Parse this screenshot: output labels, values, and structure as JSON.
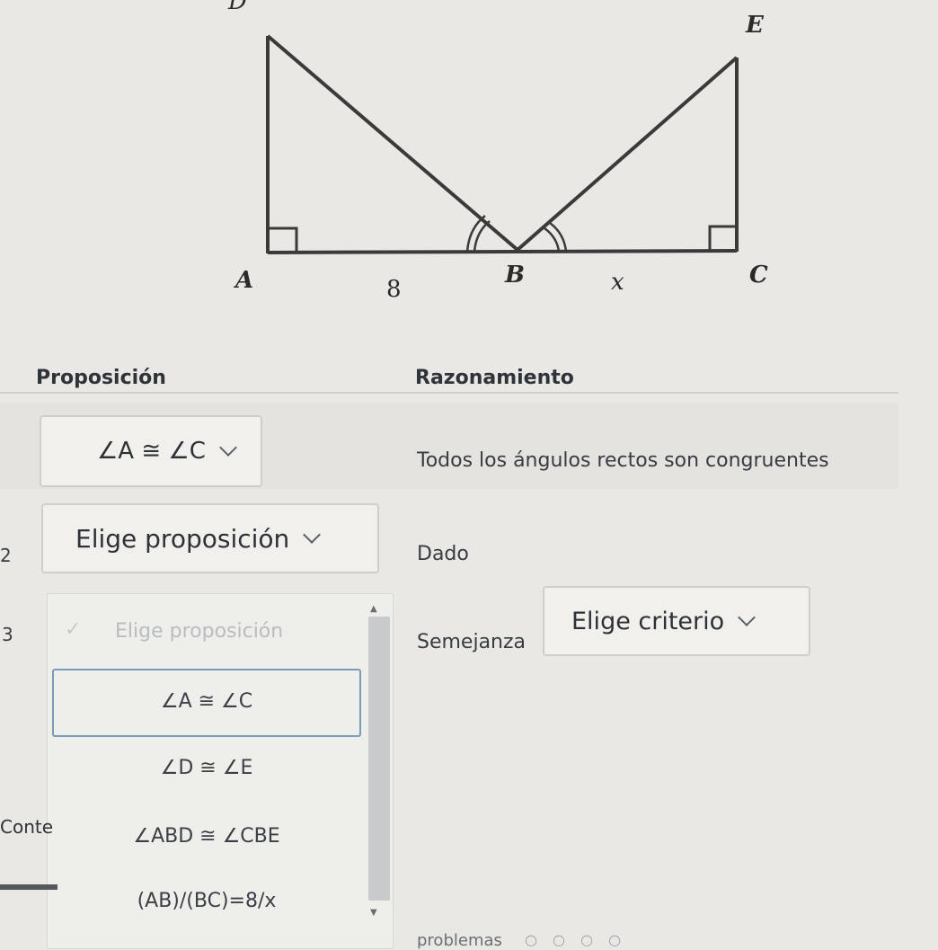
{
  "figure": {
    "labels": {
      "A": "A",
      "B": "B",
      "C": "C",
      "D": "D",
      "E": "E"
    },
    "segment_AB": "8",
    "segment_BC": "x"
  },
  "table": {
    "header_proposition": "Proposición",
    "header_reasoning": "Razonamiento",
    "rows": [
      {
        "number": "",
        "proposition": "∠A ≅ ∠C",
        "reasoning": "Todos los ángulos rectos son congruentes"
      },
      {
        "number": "2",
        "proposition": "Elige proposición",
        "reasoning": "Dado"
      },
      {
        "number": "3",
        "proposition": "Elige proposición",
        "reasoning": "Semejanza",
        "criterion": "Elige criterio"
      }
    ]
  },
  "dropdown": {
    "placeholder": "Elige proposición",
    "check_glyph": "✓",
    "options": [
      "∠A ≅ ∠C",
      "∠D ≅ ∠E",
      "∠ABD ≅ ∠CBE",
      "(AB)/(BC)=8/x"
    ],
    "selected_index": 0
  },
  "side": {
    "label": "Conte"
  },
  "footer": {
    "label": "problemas",
    "dots": "○ ○ ○ ○"
  },
  "colors": {
    "background": "#e9e8e5",
    "selected_border": "#7a9ab8"
  }
}
